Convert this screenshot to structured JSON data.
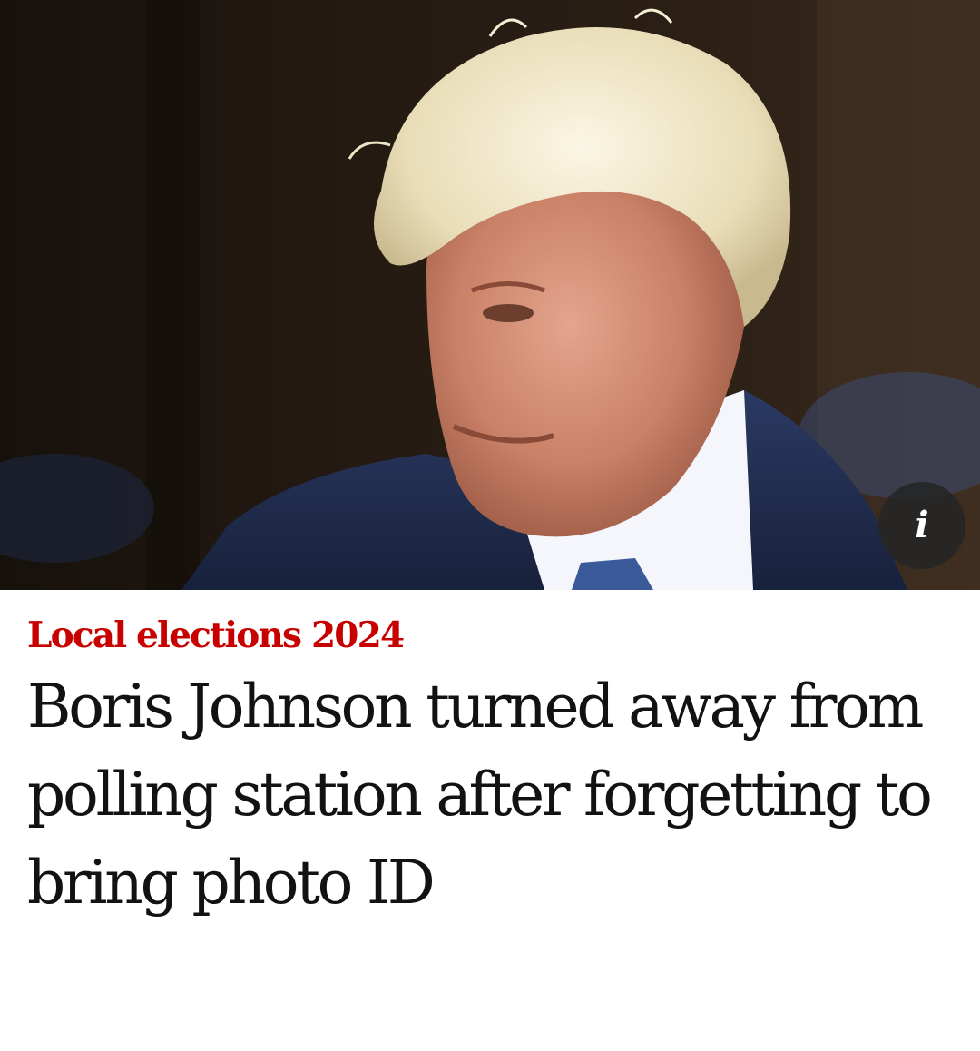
{
  "hero": {
    "image_icon": "portrait-photo",
    "info_icon": "info-icon",
    "info_glyph": "i"
  },
  "article": {
    "kicker": "Local elections 2024",
    "headline": "Boris Johnson turned away from polling station after forgetting to bring photo ID"
  },
  "colors": {
    "kicker": "#c70000",
    "headline": "#121212",
    "background": "#ffffff"
  }
}
